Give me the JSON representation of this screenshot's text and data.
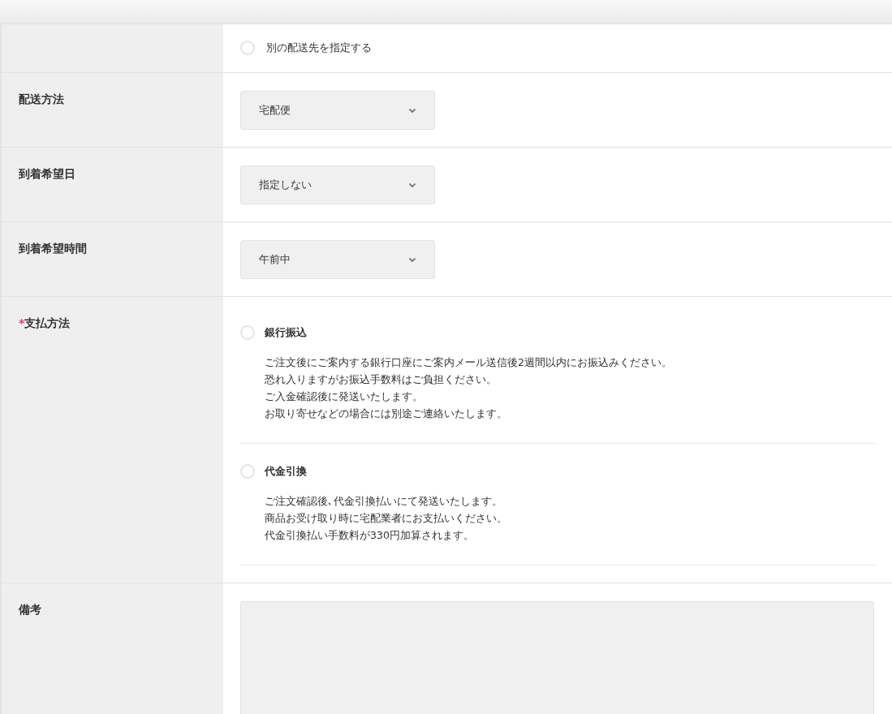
{
  "address_row": {
    "options": [
      {
        "label": "別の配送先を指定する",
        "selected": false
      }
    ]
  },
  "select_rows": [
    {
      "label": "配送方法",
      "value": "宅配便"
    },
    {
      "label": "到着希望日",
      "value": "指定しない"
    },
    {
      "label": "到着希望時間",
      "value": "午前中"
    }
  ],
  "payment": {
    "required_mark": "*",
    "label": "支払方法",
    "options": [
      {
        "label": "銀行振込",
        "selected": false,
        "description": [
          "ご注文後にご案内する銀行口座にご案内メール送信後2週間以内にお振込みください。",
          "恐れ入りますがお振込手数料はご負担ください。",
          "ご入金確認後に発送いたします。",
          "お取り寄せなどの場合には別途ご連絡いたします。"
        ]
      },
      {
        "label": "代金引換",
        "selected": false,
        "description": [
          "ご注文確認後､代金引換払いにて発送いたします。",
          "商品お受け取り時に宅配業者にお支払いください。",
          "代金引換払い手数料が330円加算されます。"
        ]
      }
    ]
  },
  "remarks": {
    "label": "備考"
  }
}
